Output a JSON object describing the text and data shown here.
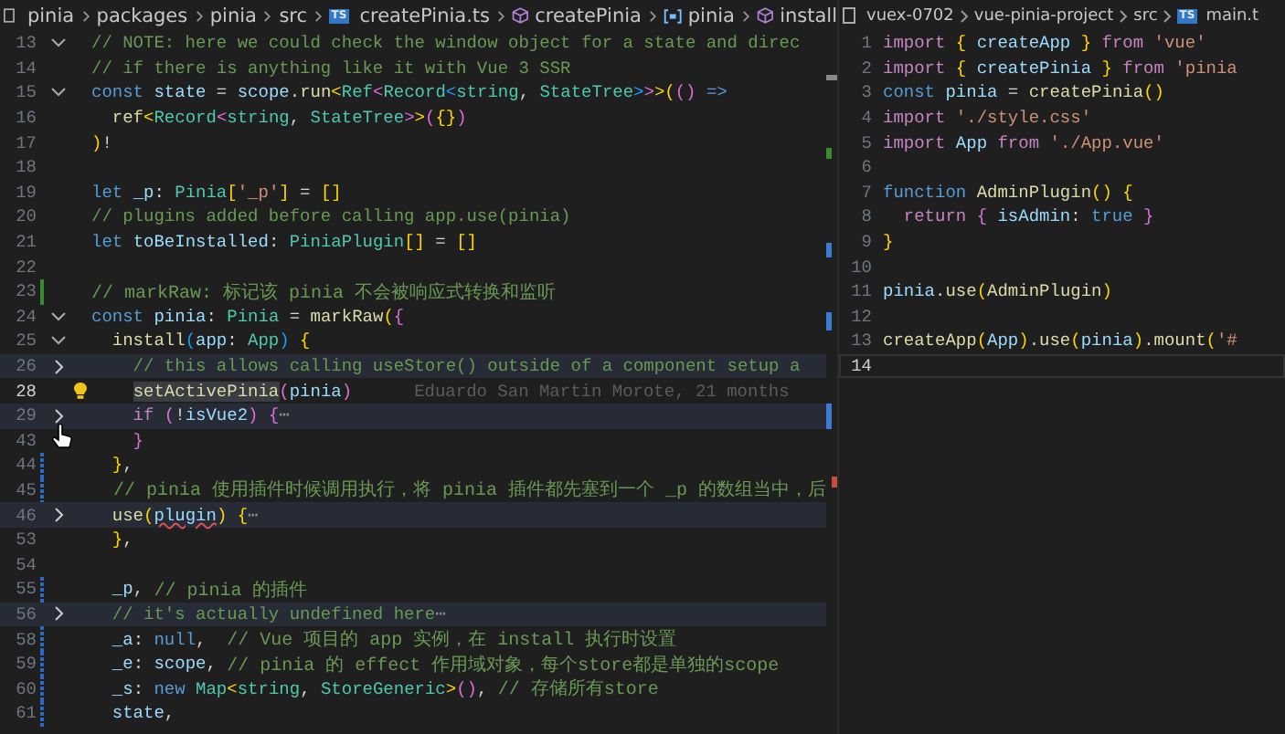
{
  "editors": [
    {
      "breadcrumb": [
        {
          "text": "pinia"
        },
        {
          "text": "packages"
        },
        {
          "text": "pinia"
        },
        {
          "text": "src"
        },
        {
          "text": "createPinia.ts",
          "kind": "typescript",
          "badge": "TS"
        },
        {
          "text": "createPinia",
          "kind": "method"
        },
        {
          "text": "pinia",
          "kind": "variable"
        },
        {
          "text": "install",
          "kind": "method"
        }
      ],
      "lightbulb": true,
      "lines": [
        {
          "number": "13",
          "kind": "expanded",
          "current": false,
          "added": false,
          "modified": false,
          "tokens": [
            {
              "kind": "cm",
              "text": "// NOTE: here we could check the window object for a state and direc"
            }
          ]
        },
        {
          "number": "14",
          "kind": "plain",
          "current": false,
          "added": false,
          "modified": false,
          "tokens": [
            {
              "kind": "cm",
              "text": "// if there is anything like it with Vue 3 SSR"
            }
          ]
        },
        {
          "number": "15",
          "kind": "expanded",
          "current": false,
          "added": false,
          "modified": false,
          "tokens": [
            {
              "kind": "kw",
              "text": "const "
            },
            {
              "kind": "var",
              "text": "state"
            },
            {
              "kind": "pl",
              "text": " = "
            },
            {
              "kind": "var",
              "text": "scope"
            },
            {
              "kind": "pl",
              "text": "."
            },
            {
              "kind": "fn",
              "text": "run"
            },
            {
              "kind": "b1",
              "text": "<"
            },
            {
              "kind": "ty",
              "text": "Ref"
            },
            {
              "kind": "b2",
              "text": "<"
            },
            {
              "kind": "ty",
              "text": "Record"
            },
            {
              "kind": "b3",
              "text": "<"
            },
            {
              "kind": "ty",
              "text": "string"
            },
            {
              "kind": "pl",
              "text": ", "
            },
            {
              "kind": "ty",
              "text": "StateTree"
            },
            {
              "kind": "b3",
              "text": ">"
            },
            {
              "kind": "b2",
              "text": ">"
            },
            {
              "kind": "b1",
              "text": ">"
            },
            {
              "kind": "b1",
              "text": "("
            },
            {
              "kind": "b2",
              "text": "()"
            },
            {
              "kind": "kw",
              "text": " =>"
            }
          ]
        },
        {
          "number": "16",
          "kind": "plain",
          "current": false,
          "added": false,
          "modified": false,
          "tokens": [
            {
              "kind": "fn",
              "text": "  ref"
            },
            {
              "kind": "b1",
              "text": "<"
            },
            {
              "kind": "ty",
              "text": "Record"
            },
            {
              "kind": "b2",
              "text": "<"
            },
            {
              "kind": "ty",
              "text": "string"
            },
            {
              "kind": "pl",
              "text": ", "
            },
            {
              "kind": "ty",
              "text": "StateTree"
            },
            {
              "kind": "b2",
              "text": ">"
            },
            {
              "kind": "b1",
              "text": ">"
            },
            {
              "kind": "b2",
              "text": "("
            },
            {
              "kind": "b1",
              "text": "{}"
            },
            {
              "kind": "b2",
              "text": ")"
            }
          ]
        },
        {
          "number": "17",
          "kind": "plain",
          "current": false,
          "added": false,
          "modified": false,
          "tokens": [
            {
              "kind": "b1",
              "text": ")"
            },
            {
              "kind": "pl",
              "text": "!"
            }
          ]
        },
        {
          "number": "18",
          "kind": "plain",
          "current": false,
          "added": false,
          "modified": false
        },
        {
          "number": "19",
          "kind": "plain",
          "current": false,
          "added": false,
          "modified": false,
          "tokens": [
            {
              "kind": "kw",
              "text": "let "
            },
            {
              "kind": "var",
              "text": "_p"
            },
            {
              "kind": "pl",
              "text": ": "
            },
            {
              "kind": "ty",
              "text": "Pinia"
            },
            {
              "kind": "b1",
              "text": "["
            },
            {
              "kind": "str",
              "text": "'_p'"
            },
            {
              "kind": "b1",
              "text": "]"
            },
            {
              "kind": "pl",
              "text": " = "
            },
            {
              "kind": "b1",
              "text": "[]"
            }
          ]
        },
        {
          "number": "20",
          "kind": "plain",
          "current": false,
          "added": false,
          "modified": false,
          "tokens": [
            {
              "kind": "cm",
              "text": "// plugins added before calling app.use(pinia)"
            }
          ]
        },
        {
          "number": "21",
          "kind": "plain",
          "current": false,
          "added": false,
          "modified": false,
          "tokens": [
            {
              "kind": "kw",
              "text": "let "
            },
            {
              "kind": "var",
              "text": "toBeInstalled"
            },
            {
              "kind": "pl",
              "text": ": "
            },
            {
              "kind": "ty",
              "text": "PiniaPlugin"
            },
            {
              "kind": "b1",
              "text": "[]"
            },
            {
              "kind": "pl",
              "text": " = "
            },
            {
              "kind": "b1",
              "text": "[]"
            }
          ]
        },
        {
          "number": "22",
          "kind": "plain",
          "current": false,
          "added": false,
          "modified": false
        },
        {
          "number": "23",
          "kind": "plain",
          "current": false,
          "added": true,
          "modified": false,
          "tokens": [
            {
              "kind": "cmx",
              "text": "// markRaw: 标记该 pinia 不会被响应式转换和监听"
            }
          ]
        },
        {
          "number": "24",
          "kind": "expanded",
          "current": false,
          "added": false,
          "modified": false,
          "tokens": [
            {
              "kind": "kw",
              "text": "const "
            },
            {
              "kind": "var",
              "text": "pinia"
            },
            {
              "kind": "pl",
              "text": ": "
            },
            {
              "kind": "ty",
              "text": "Pinia"
            },
            {
              "kind": "pl",
              "text": " = "
            },
            {
              "kind": "fn",
              "text": "markRaw"
            },
            {
              "kind": "b1",
              "text": "("
            },
            {
              "kind": "b2",
              "text": "{"
            }
          ]
        },
        {
          "number": "25",
          "kind": "expanded",
          "current": false,
          "added": false,
          "modified": false,
          "tokens": [
            {
              "kind": "fn",
              "text": "  install"
            },
            {
              "kind": "b3",
              "text": "("
            },
            {
              "kind": "var",
              "text": "app"
            },
            {
              "kind": "pl",
              "text": ": "
            },
            {
              "kind": "ty",
              "text": "App"
            },
            {
              "kind": "b3",
              "text": ")"
            },
            {
              "kind": "b1",
              "text": " {"
            }
          ]
        },
        {
          "number": "26",
          "kind": "collapsed",
          "current": false,
          "added": false,
          "modified": false,
          "tokens": [
            {
              "kind": "cm",
              "text": "    // this allows calling useStore() outside of a component setup a"
            }
          ]
        },
        {
          "number": "28",
          "kind": "plain",
          "current": true,
          "added": false,
          "modified": false,
          "blame": "Eduardo San Martin Morote, 21 months",
          "tokens": [
            {
              "kind": "hl",
              "text": "    setActivePinia"
            },
            {
              "kind": "b2",
              "text": "("
            },
            {
              "kind": "var",
              "text": "pinia"
            },
            {
              "kind": "b2",
              "text": ")"
            }
          ]
        },
        {
          "number": "29",
          "kind": "collapsed",
          "current": false,
          "added": false,
          "modified": false,
          "tokens": [
            {
              "kind": "ctl",
              "text": "    if"
            },
            {
              "kind": "b2",
              "text": " ("
            },
            {
              "kind": "pl",
              "text": "!"
            },
            {
              "kind": "var",
              "text": "isVue2"
            },
            {
              "kind": "b2",
              "text": ")"
            },
            {
              "kind": "b2",
              "text": " {"
            },
            {
              "kind": "ell",
              "text": "⋯"
            }
          ]
        },
        {
          "number": "43",
          "kind": "plain",
          "current": false,
          "added": false,
          "modified": false,
          "tokens": [
            {
              "kind": "b2",
              "text": "    }"
            }
          ]
        },
        {
          "number": "44",
          "kind": "plain",
          "current": false,
          "added": false,
          "modified": true,
          "tokens": [
            {
              "kind": "b1",
              "text": "  }"
            },
            {
              "kind": "pl",
              "text": ","
            }
          ]
        },
        {
          "number": "45",
          "kind": "plain",
          "current": false,
          "added": false,
          "modified": true,
          "tokens": [
            {
              "kind": "cmx",
              "text": "  // pinia 使用插件时候调用执行，将 pinia 插件都先塞到一个 _p 的数组当中，后"
            }
          ]
        },
        {
          "number": "46",
          "kind": "collapsed",
          "current": false,
          "added": false,
          "modified": false,
          "tokens": [
            {
              "kind": "fn",
              "text": "  use"
            },
            {
              "kind": "b1",
              "text": "("
            },
            {
              "kind": "err",
              "text": "plugin"
            },
            {
              "kind": "b1",
              "text": ")"
            },
            {
              "kind": "b1",
              "text": " {"
            },
            {
              "kind": "ell",
              "text": "⋯"
            }
          ]
        },
        {
          "number": "53",
          "kind": "plain",
          "current": false,
          "added": false,
          "modified": false,
          "tokens": [
            {
              "kind": "b1",
              "text": "  }"
            },
            {
              "kind": "pl",
              "text": ","
            }
          ]
        },
        {
          "number": "54",
          "kind": "plain",
          "current": false,
          "added": false,
          "modified": false
        },
        {
          "number": "55",
          "kind": "plain",
          "current": false,
          "added": false,
          "modified": true,
          "tokens": [
            {
              "kind": "var",
              "text": "  _p"
            },
            {
              "kind": "pl",
              "text": ", "
            },
            {
              "kind": "cmx",
              "text": "// pinia 的插件"
            }
          ]
        },
        {
          "number": "56",
          "kind": "collapsed",
          "current": false,
          "added": false,
          "modified": false,
          "tokens": [
            {
              "kind": "cm",
              "text": "  // it's actually undefined here"
            },
            {
              "kind": "ell",
              "text": "⋯"
            }
          ]
        },
        {
          "number": "58",
          "kind": "plain",
          "current": false,
          "added": false,
          "modified": true,
          "tokens": [
            {
              "kind": "var",
              "text": "  _a"
            },
            {
              "kind": "pl",
              "text": ": "
            },
            {
              "kind": "kw",
              "text": "null"
            },
            {
              "kind": "pl",
              "text": ",  "
            },
            {
              "kind": "cmx",
              "text": "// Vue 项目的 app 实例，在 install 执行时设置"
            }
          ]
        },
        {
          "number": "59",
          "kind": "plain",
          "current": false,
          "added": false,
          "modified": true,
          "tokens": [
            {
              "kind": "var",
              "text": "  _e"
            },
            {
              "kind": "pl",
              "text": ": "
            },
            {
              "kind": "var",
              "text": "scope"
            },
            {
              "kind": "pl",
              "text": ", "
            },
            {
              "kind": "cmx",
              "text": "// pinia 的 effect 作用域对象，每个store都是单独的scope"
            }
          ]
        },
        {
          "number": "60",
          "kind": "plain",
          "current": false,
          "added": false,
          "modified": true,
          "tokens": [
            {
              "kind": "var",
              "text": "  _s"
            },
            {
              "kind": "pl",
              "text": ": "
            },
            {
              "kind": "kw",
              "text": "new "
            },
            {
              "kind": "ty",
              "text": "Map"
            },
            {
              "kind": "b1",
              "text": "<"
            },
            {
              "kind": "ty",
              "text": "string"
            },
            {
              "kind": "pl",
              "text": ", "
            },
            {
              "kind": "ty",
              "text": "StoreGeneric"
            },
            {
              "kind": "b1",
              "text": ">"
            },
            {
              "kind": "b2",
              "text": "()"
            },
            {
              "kind": "pl",
              "text": ", "
            },
            {
              "kind": "cmx",
              "text": "// 存储所有store"
            }
          ]
        },
        {
          "number": "61",
          "kind": "plain",
          "current": false,
          "added": false,
          "modified": true,
          "tokens": [
            {
              "kind": "var",
              "text": "  state"
            },
            {
              "kind": "pl",
              "text": ","
            }
          ]
        }
      ]
    },
    {
      "breadcrumb": [
        {
          "text": "vuex-0702"
        },
        {
          "text": "vue-pinia-project"
        },
        {
          "text": "src"
        },
        {
          "text": "main.t",
          "kind": "typescript",
          "badge": "TS"
        }
      ],
      "lines": [
        {
          "number": "1",
          "kind": "plain",
          "current": false,
          "added": false,
          "modified": false,
          "tokens": [
            {
              "kind": "ctl",
              "text": "import "
            },
            {
              "kind": "b1",
              "text": "{"
            },
            {
              "kind": "var",
              "text": " createApp "
            },
            {
              "kind": "b1",
              "text": "}"
            },
            {
              "kind": "ctl",
              "text": " from "
            },
            {
              "kind": "str",
              "text": "'vue'"
            }
          ]
        },
        {
          "number": "2",
          "kind": "plain",
          "current": false,
          "added": false,
          "modified": false,
          "tokens": [
            {
              "kind": "ctl",
              "text": "import "
            },
            {
              "kind": "b1",
              "text": "{"
            },
            {
              "kind": "var",
              "text": " createPinia "
            },
            {
              "kind": "b1",
              "text": "}"
            },
            {
              "kind": "ctl",
              "text": " from "
            },
            {
              "kind": "str",
              "text": "'pinia"
            }
          ]
        },
        {
          "number": "3",
          "kind": "plain",
          "current": false,
          "added": false,
          "modified": false,
          "tokens": [
            {
              "kind": "kw",
              "text": "const "
            },
            {
              "kind": "var",
              "text": "pinia"
            },
            {
              "kind": "pl",
              "text": " = "
            },
            {
              "kind": "fn",
              "text": "createPinia"
            },
            {
              "kind": "b1",
              "text": "()"
            }
          ]
        },
        {
          "number": "4",
          "kind": "plain",
          "current": false,
          "added": false,
          "modified": false,
          "tokens": [
            {
              "kind": "ctl",
              "text": "import "
            },
            {
              "kind": "str",
              "text": "'./style.css'"
            }
          ]
        },
        {
          "number": "5",
          "kind": "plain",
          "current": false,
          "added": false,
          "modified": false,
          "tokens": [
            {
              "kind": "ctl",
              "text": "import "
            },
            {
              "kind": "var",
              "text": "App"
            },
            {
              "kind": "ctl",
              "text": " from "
            },
            {
              "kind": "str",
              "text": "'./App.vue'"
            }
          ]
        },
        {
          "number": "6",
          "kind": "plain",
          "current": false,
          "added": false,
          "modified": false
        },
        {
          "number": "7",
          "kind": "plain",
          "current": false,
          "added": false,
          "modified": false,
          "tokens": [
            {
              "kind": "kw",
              "text": "function "
            },
            {
              "kind": "fn",
              "text": "AdminPlugin"
            },
            {
              "kind": "b1",
              "text": "()"
            },
            {
              "kind": "b1",
              "text": " {"
            }
          ]
        },
        {
          "number": "8",
          "kind": "plain",
          "current": false,
          "added": false,
          "modified": false,
          "tokens": [
            {
              "kind": "ctl",
              "text": "  return "
            },
            {
              "kind": "b2",
              "text": "{"
            },
            {
              "kind": "var",
              "text": " isAdmin"
            },
            {
              "kind": "pl",
              "text": ": "
            },
            {
              "kind": "kw",
              "text": "true "
            },
            {
              "kind": "b2",
              "text": "}"
            }
          ]
        },
        {
          "number": "9",
          "kind": "plain",
          "current": false,
          "added": false,
          "modified": false,
          "tokens": [
            {
              "kind": "b1",
              "text": "}"
            }
          ]
        },
        {
          "number": "10",
          "kind": "plain",
          "current": false,
          "added": false,
          "modified": false
        },
        {
          "number": "11",
          "kind": "plain",
          "current": false,
          "added": false,
          "modified": false,
          "tokens": [
            {
              "kind": "var",
              "text": "pinia"
            },
            {
              "kind": "pl",
              "text": "."
            },
            {
              "kind": "fn",
              "text": "use"
            },
            {
              "kind": "b1",
              "text": "("
            },
            {
              "kind": "fn",
              "text": "AdminPlugin"
            },
            {
              "kind": "b1",
              "text": ")"
            }
          ]
        },
        {
          "number": "12",
          "kind": "plain",
          "current": false,
          "added": false,
          "modified": false
        },
        {
          "number": "13",
          "kind": "plain",
          "current": false,
          "added": false,
          "modified": false,
          "tokens": [
            {
              "kind": "fn",
              "text": "createApp"
            },
            {
              "kind": "b1",
              "text": "("
            },
            {
              "kind": "var",
              "text": "App"
            },
            {
              "kind": "b1",
              "text": ")"
            },
            {
              "kind": "pl",
              "text": "."
            },
            {
              "kind": "fn",
              "text": "use"
            },
            {
              "kind": "b1",
              "text": "("
            },
            {
              "kind": "var",
              "text": "pinia"
            },
            {
              "kind": "b1",
              "text": ")"
            },
            {
              "kind": "pl",
              "text": "."
            },
            {
              "kind": "fn",
              "text": "mount"
            },
            {
              "kind": "b1",
              "text": "("
            },
            {
              "kind": "str",
              "text": "'#"
            }
          ]
        },
        {
          "number": "14",
          "kind": "plain",
          "current": true,
          "added": false,
          "modified": false
        }
      ]
    }
  ]
}
